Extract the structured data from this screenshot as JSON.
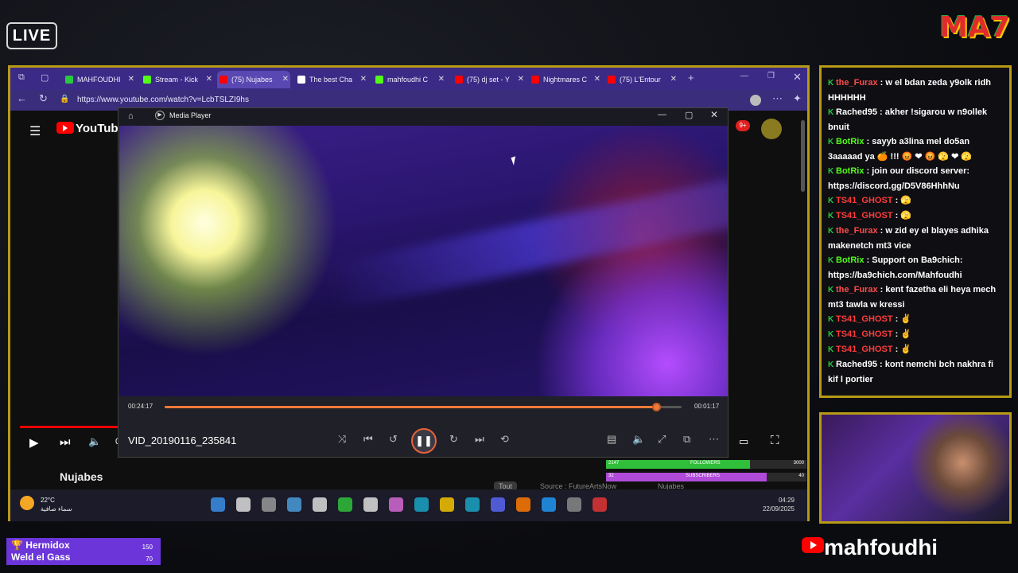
{
  "overlay": {
    "live_label": "LIVE",
    "logo_text": "MA7",
    "handle": "mahfoudhi"
  },
  "browser": {
    "tabs": [
      {
        "label": "MAHFOUDHI",
        "color": "#28c840"
      },
      {
        "label": "Stream - Kick",
        "color": "#53fc18"
      },
      {
        "label": "(75) Nujabes",
        "color": "#ff0000"
      },
      {
        "label": "The best Cha",
        "color": "#ffffff"
      },
      {
        "label": "mahfoudhi C",
        "color": "#53fc18"
      },
      {
        "label": "(75) dj set - Y",
        "color": "#ff0000"
      },
      {
        "label": "Nightmares C",
        "color": "#ff0000"
      },
      {
        "label": "(75) L'Entour",
        "color": "#ff0000"
      }
    ],
    "url": "https://www.youtube.com/watch?v=LcbTSLZI9hs"
  },
  "youtube": {
    "logo": "YouTube",
    "channel": "Nujabes",
    "notif_badge": "9+",
    "time_prefix": "0"
  },
  "player": {
    "title": "Media Player",
    "elapsed": "00:24:17",
    "remaining": "00:01:17",
    "progress": 0.95,
    "file_name": "VID_20190116_235841"
  },
  "taskbar": {
    "temp": "22°C",
    "weather_text": "سماء صافية",
    "time": "04:29",
    "date": "22/09/2025",
    "hint_left": "Tout",
    "hint_mid": "Source : FutureArtsNow",
    "hint_right": "Nujabes"
  },
  "stats": {
    "followers_current": "2147",
    "followers_label": "FOLLOWERS",
    "followers_goal": "3000",
    "followers_ratio": 0.72,
    "subs_current": "32",
    "subs_label": "SUBSCRIBERS",
    "subs_goal": "40",
    "subs_ratio": 0.8
  },
  "chat": [
    {
      "user": "the_Furax",
      "color": "#ff4a4a",
      "text": "w el bdan zeda y9olk ridh HHHHHH"
    },
    {
      "user": "Rached95",
      "color": "#ffffff",
      "text": "akher !sigarou w n9ollek bnuit"
    },
    {
      "user": "BotRix",
      "color": "#53fc18",
      "text": "sayyb a3lina mel do5an 3aaaaad ya 🍊 !!! 😡 ❤ 😡 🫣 ❤ 🫣"
    },
    {
      "user": "BotRix",
      "color": "#53fc18",
      "text": "join our discord server: https://discord.gg/D5V86HhhNu"
    },
    {
      "user": "TS41_GHOST",
      "color": "#ff3b3b",
      "text": "🫣"
    },
    {
      "user": "TS41_GHOST",
      "color": "#ff3b3b",
      "text": "🫣"
    },
    {
      "user": "the_Furax",
      "color": "#ff4a4a",
      "text": "w zid ey el blayes adhika makenetch mt3 vice"
    },
    {
      "user": "BotRix",
      "color": "#53fc18",
      "text": "Support on Ba9chich: https://ba9chich.com/Mahfoudhi"
    },
    {
      "user": "the_Furax",
      "color": "#ff4a4a",
      "text": "kent fazetha eli heya mech mt3 tawla w kressi"
    },
    {
      "user": "TS41_GHOST",
      "color": "#ff3b3b",
      "text": "✌"
    },
    {
      "user": "TS41_GHOST",
      "color": "#ff3b3b",
      "text": "✌"
    },
    {
      "user": "TS41_GHOST",
      "color": "#ff3b3b",
      "text": "✌"
    },
    {
      "user": "Rached95",
      "color": "#ffffff",
      "text": "kont nemchi bch nakhra fi kif l portier"
    }
  ],
  "recent": {
    "name1": "Hermidox",
    "name2": "Weld el Gass",
    "count1": "150",
    "count2": "70"
  }
}
